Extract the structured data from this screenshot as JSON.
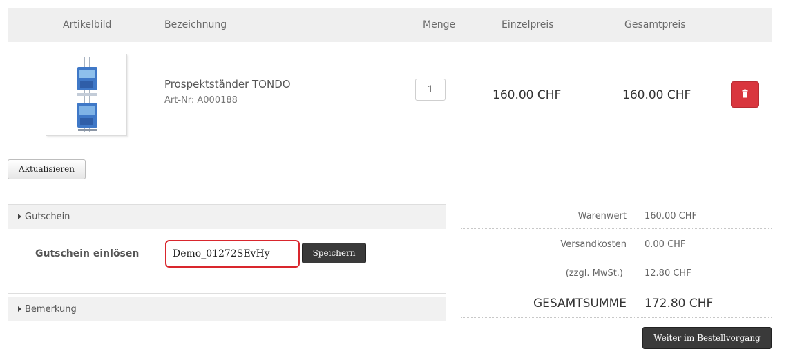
{
  "table": {
    "headers": {
      "image": "Artikelbild",
      "name": "Bezeichnung",
      "qty": "Menge",
      "unit_price": "Einzelpreis",
      "total_price": "Gesamtpreis"
    },
    "items": [
      {
        "name": "Prospektständer TONDO",
        "article_no": "Art-Nr: A000188",
        "quantity": "1",
        "unit_price": "160.00 CHF",
        "total_price": "160.00 CHF",
        "image_icon": "brochure-stand-image"
      }
    ],
    "delete_icon": "trash-icon"
  },
  "update_button": "Aktualisieren",
  "voucher_panel": {
    "title": "Gutschein",
    "label": "Gutschein einlösen",
    "code": "Demo_01272SEvHy",
    "save_button": "Speichern"
  },
  "remark_panel": {
    "title": "Bemerkung"
  },
  "totals": {
    "rows": [
      {
        "label": "Warenwert",
        "value": "160.00  CHF"
      },
      {
        "label": "Versandkosten",
        "value": "0.00  CHF"
      },
      {
        "label": "(zzgl. MwSt.)",
        "value": "12.80  CHF"
      }
    ],
    "grand_label": "GESAMTSUMME",
    "grand_value": "172.80  CHF"
  },
  "continue_button": "Weiter im Bestellvorgang",
  "colors": {
    "delete": "#d9363e",
    "highlight": "#d9262d",
    "dark_button": "#3a3a3a"
  }
}
